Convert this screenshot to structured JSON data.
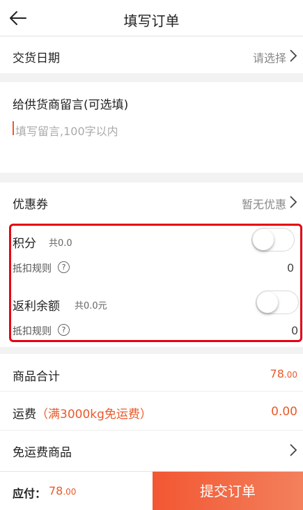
{
  "header": {
    "title": "填写订单",
    "back_icon": "arrow-left-icon"
  },
  "delivery": {
    "label": "交货日期",
    "value": "请选择"
  },
  "message": {
    "label": "给供货商留言(可选填)",
    "placeholder": "填写留言,100字以内"
  },
  "coupon": {
    "label": "优惠券",
    "value": "暂无优惠"
  },
  "points": {
    "label": "积分",
    "total": "共0.0",
    "rule": "抵扣规则",
    "value": "0",
    "enabled": false
  },
  "rebate": {
    "label": "返利余额",
    "total": "共0.0元",
    "rule": "抵扣规则",
    "value": "0",
    "enabled": false
  },
  "summary": {
    "goods_label": "商品合计",
    "goods_main": "78",
    "goods_dec": ".00",
    "shipping_label": "运费",
    "shipping_note": "（满3000kg免运费）",
    "shipping_value": "0.00",
    "free_shipping_label": "免运费商品"
  },
  "footer": {
    "pay_label": "应付：",
    "pay_main": "78",
    "pay_dec": ".00",
    "submit": "提交订单"
  },
  "colors": {
    "accent": "#e95a2b",
    "highlight": "#e60012"
  }
}
